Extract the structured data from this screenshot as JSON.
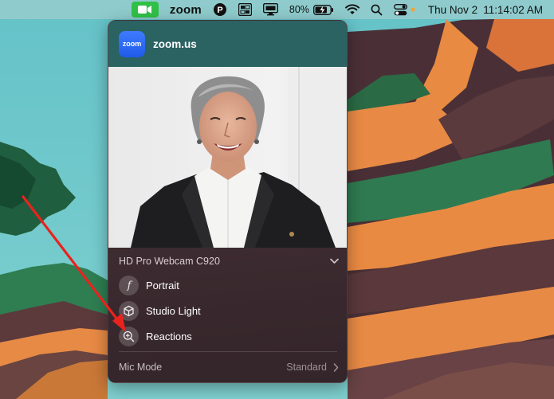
{
  "menubar": {
    "app_label": "zoom",
    "battery_percent": "80%",
    "date": "Thu Nov 2",
    "time": "11:14:02 AM",
    "icons": [
      "zoom-camera-icon",
      "hook-p-icon",
      "grid-app-icon",
      "display-monitor-icon",
      "battery-charging-icon",
      "wifi-icon",
      "search-icon",
      "control-center-icon"
    ]
  },
  "panel": {
    "app_icon_text": "zoom",
    "app_name": "zoom.us",
    "camera_name": "HD Pro Webcam C920",
    "effects": [
      {
        "label": "Portrait",
        "icon": "f-aperture-icon"
      },
      {
        "label": "Studio Light",
        "icon": "cube-icon"
      },
      {
        "label": "Reactions",
        "icon": "reactions-magnifier-icon"
      }
    ],
    "mic_mode_label": "Mic Mode",
    "mic_mode_value": "Standard"
  },
  "colors": {
    "header": "#2b6262",
    "panel": "#3e2c31",
    "zoom_green": "#30c048",
    "annotation_arrow": "#e8231e"
  }
}
